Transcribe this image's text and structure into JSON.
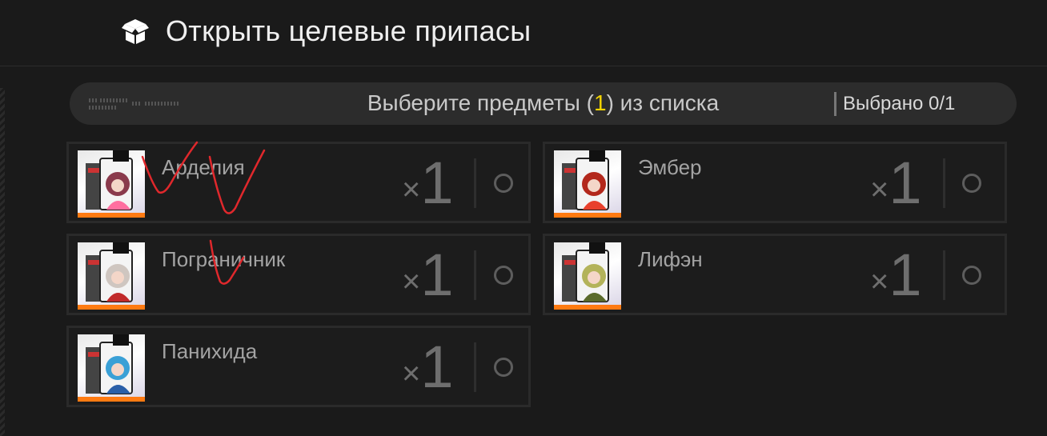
{
  "header": {
    "title": "Открыть целевые припасы",
    "icon": "open-box-icon"
  },
  "banner": {
    "prompt_before": "Выберите предметы (",
    "prompt_count": "1",
    "prompt_after": ") из списка",
    "selected_label": "Выбрано 0/1",
    "highlight_color": "#f2d300"
  },
  "items": [
    {
      "name": "Арделия",
      "qty_prefix": "×",
      "qty": "1",
      "hair": "#8a3a4c",
      "accent": "#ff6fa0"
    },
    {
      "name": "Эмбер",
      "qty_prefix": "×",
      "qty": "1",
      "hair": "#b3281c",
      "accent": "#e8402c"
    },
    {
      "name": "Пограничник",
      "qty_prefix": "×",
      "qty": "1",
      "hair": "#cfc6c0",
      "accent": "#c12a2a"
    },
    {
      "name": "Лифэн",
      "qty_prefix": "×",
      "qty": "1",
      "hair": "#b3b35a",
      "accent": "#5a6a2a"
    },
    {
      "name": "Панихида",
      "qty_prefix": "×",
      "qty": "1",
      "hair": "#3aa0d6",
      "accent": "#2a5fa8"
    }
  ],
  "colors": {
    "background": "#1a1a1a",
    "item_bar": "#ff7a12",
    "annotation_ink": "#e0282c"
  }
}
